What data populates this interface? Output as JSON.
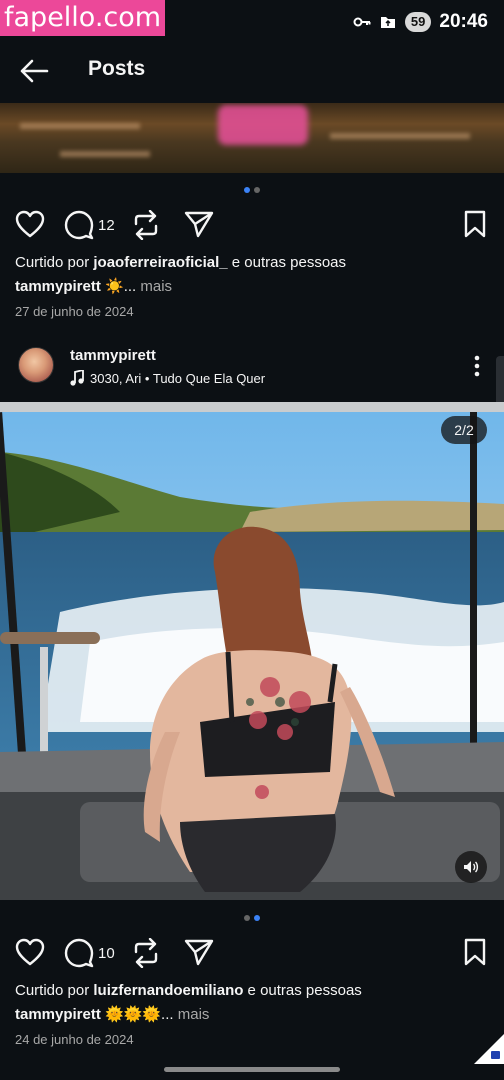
{
  "watermark": "fapello.com",
  "status_bar": {
    "battery": "59",
    "time": "20:46",
    "icons": [
      "vpn-key-icon",
      "notification-folder-icon"
    ]
  },
  "header": {
    "title": "Posts",
    "back_icon": "arrow-left-icon"
  },
  "post_1": {
    "dots_active_index": 0,
    "dots_count": 2,
    "comment_count": "12",
    "likes_prefix": "Curtido por ",
    "likes_user": "joaoferreiraoficial_",
    "likes_suffix": " e outras pessoas",
    "caption_user": "tammypirett",
    "caption_text": " ☀️...",
    "caption_more": " mais",
    "date": "27 de junho de 2024"
  },
  "post_2": {
    "username": "tammypirett",
    "music": "3030, Ari • Tudo Que Ela Quer",
    "photo_counter": "2/2",
    "dots_active_index": 1,
    "dots_count": 2,
    "comment_count": "10",
    "likes_prefix": "Curtido por ",
    "likes_user": "luizfernandoemiliano",
    "likes_suffix": " e outras pessoas",
    "caption_user": "tammypirett",
    "caption_text": " 🌞🌞🌞...",
    "caption_more": " mais",
    "date": "24 de junho de 2024"
  },
  "colors": {
    "background": "#0c1014",
    "text": "#f5f5f5",
    "muted": "#a8a8a8",
    "accent_dot": "#3b82f6",
    "watermark_bg": "#ec4899"
  }
}
